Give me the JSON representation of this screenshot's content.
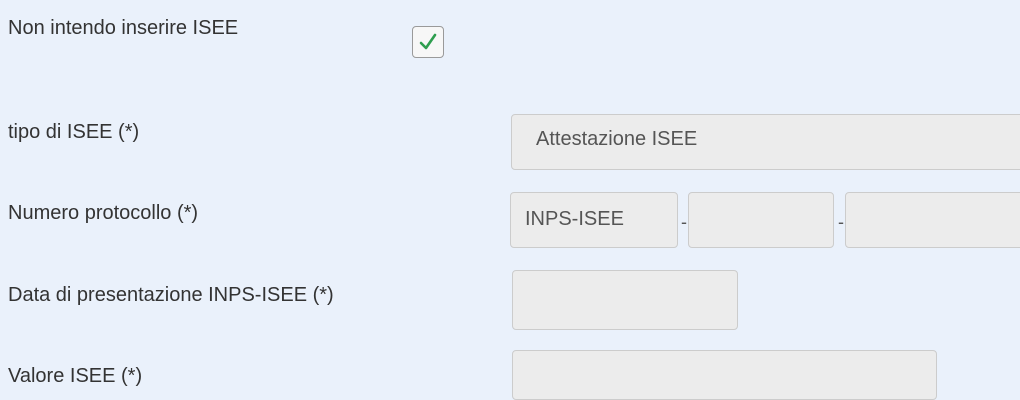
{
  "form": {
    "no_isee": {
      "label": "Non intendo inserire ISEE",
      "checked": true
    },
    "tipo_isee": {
      "label": "tipo di ISEE (*)",
      "value": "Attestazione ISEE"
    },
    "numero_protocollo": {
      "label": "Numero protocollo (*)",
      "prefix": "INPS-ISEE",
      "separator": "-",
      "part2": "",
      "part3": ""
    },
    "data_presentazione": {
      "label": "Data di presentazione INPS-ISEE (*)",
      "value": ""
    },
    "valore_isee": {
      "label": "Valore ISEE (*)",
      "value": ""
    }
  },
  "colors": {
    "background": "#eaf1fb",
    "field_background": "#ececec",
    "checkmark": "#2e9e4f"
  },
  "icons": {
    "checkmark": "check-icon"
  }
}
